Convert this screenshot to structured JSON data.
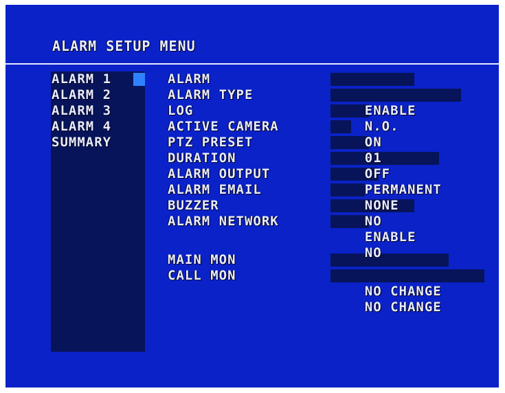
{
  "menu": {
    "title": "ALARM SETUP MENU"
  },
  "sidebar": {
    "items": [
      {
        "label": "ALARM 1",
        "selected": true
      },
      {
        "label": "ALARM 2",
        "selected": false
      },
      {
        "label": "ALARM 3",
        "selected": false
      },
      {
        "label": "ALARM 4",
        "selected": false
      },
      {
        "label": "SUMMARY",
        "selected": false
      }
    ]
  },
  "settings": [
    {
      "label": "ALARM",
      "value": "ENABLE"
    },
    {
      "label": "ALARM TYPE",
      "value": "N.O."
    },
    {
      "label": "LOG",
      "value": "ON"
    },
    {
      "label": "ACTIVE CAMERA",
      "value": "01"
    },
    {
      "label": "PTZ PRESET",
      "value": "OFF"
    },
    {
      "label": "DURATION",
      "value": "PERMANENT"
    },
    {
      "label": "ALARM OUTPUT",
      "value": "NONE"
    },
    {
      "label": "ALARM EMAIL",
      "value": "NO"
    },
    {
      "label": "BUZZER",
      "value": "ENABLE"
    },
    {
      "label": "ALARM NETWORK",
      "value": "NO"
    }
  ],
  "monitors": [
    {
      "label": "MAIN MON",
      "value": "NO CHANGE"
    },
    {
      "label": "CALL MON",
      "value": "NO CHANGE"
    }
  ],
  "colors": {
    "background": "#0a22c8",
    "text": "#e8ecff",
    "sidebar_panel": "#07145a",
    "selection_cursor": "#2e82ff"
  }
}
